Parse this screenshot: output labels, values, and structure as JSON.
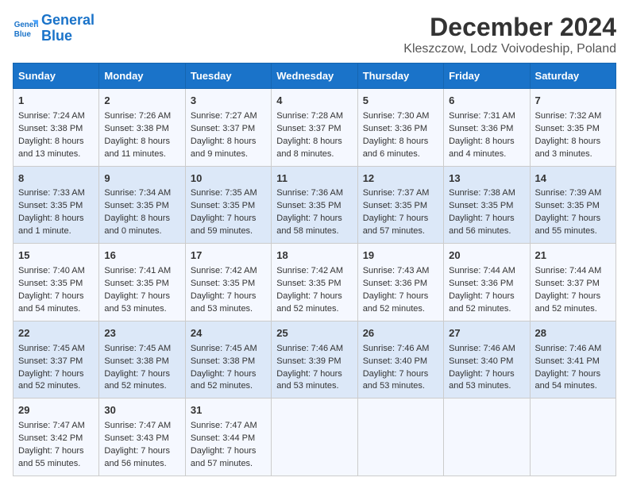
{
  "logo": {
    "line1": "General",
    "line2": "Blue"
  },
  "title": "December 2024",
  "subtitle": "Kleszczow, Lodz Voivodeship, Poland",
  "days_of_week": [
    "Sunday",
    "Monday",
    "Tuesday",
    "Wednesday",
    "Thursday",
    "Friday",
    "Saturday"
  ],
  "weeks": [
    [
      {
        "day": 1,
        "lines": [
          "Sunrise: 7:24 AM",
          "Sunset: 3:38 PM",
          "Daylight: 8 hours",
          "and 13 minutes."
        ]
      },
      {
        "day": 2,
        "lines": [
          "Sunrise: 7:26 AM",
          "Sunset: 3:38 PM",
          "Daylight: 8 hours",
          "and 11 minutes."
        ]
      },
      {
        "day": 3,
        "lines": [
          "Sunrise: 7:27 AM",
          "Sunset: 3:37 PM",
          "Daylight: 8 hours",
          "and 9 minutes."
        ]
      },
      {
        "day": 4,
        "lines": [
          "Sunrise: 7:28 AM",
          "Sunset: 3:37 PM",
          "Daylight: 8 hours",
          "and 8 minutes."
        ]
      },
      {
        "day": 5,
        "lines": [
          "Sunrise: 7:30 AM",
          "Sunset: 3:36 PM",
          "Daylight: 8 hours",
          "and 6 minutes."
        ]
      },
      {
        "day": 6,
        "lines": [
          "Sunrise: 7:31 AM",
          "Sunset: 3:36 PM",
          "Daylight: 8 hours",
          "and 4 minutes."
        ]
      },
      {
        "day": 7,
        "lines": [
          "Sunrise: 7:32 AM",
          "Sunset: 3:35 PM",
          "Daylight: 8 hours",
          "and 3 minutes."
        ]
      }
    ],
    [
      {
        "day": 8,
        "lines": [
          "Sunrise: 7:33 AM",
          "Sunset: 3:35 PM",
          "Daylight: 8 hours",
          "and 1 minute."
        ]
      },
      {
        "day": 9,
        "lines": [
          "Sunrise: 7:34 AM",
          "Sunset: 3:35 PM",
          "Daylight: 8 hours",
          "and 0 minutes."
        ]
      },
      {
        "day": 10,
        "lines": [
          "Sunrise: 7:35 AM",
          "Sunset: 3:35 PM",
          "Daylight: 7 hours",
          "and 59 minutes."
        ]
      },
      {
        "day": 11,
        "lines": [
          "Sunrise: 7:36 AM",
          "Sunset: 3:35 PM",
          "Daylight: 7 hours",
          "and 58 minutes."
        ]
      },
      {
        "day": 12,
        "lines": [
          "Sunrise: 7:37 AM",
          "Sunset: 3:35 PM",
          "Daylight: 7 hours",
          "and 57 minutes."
        ]
      },
      {
        "day": 13,
        "lines": [
          "Sunrise: 7:38 AM",
          "Sunset: 3:35 PM",
          "Daylight: 7 hours",
          "and 56 minutes."
        ]
      },
      {
        "day": 14,
        "lines": [
          "Sunrise: 7:39 AM",
          "Sunset: 3:35 PM",
          "Daylight: 7 hours",
          "and 55 minutes."
        ]
      }
    ],
    [
      {
        "day": 15,
        "lines": [
          "Sunrise: 7:40 AM",
          "Sunset: 3:35 PM",
          "Daylight: 7 hours",
          "and 54 minutes."
        ]
      },
      {
        "day": 16,
        "lines": [
          "Sunrise: 7:41 AM",
          "Sunset: 3:35 PM",
          "Daylight: 7 hours",
          "and 53 minutes."
        ]
      },
      {
        "day": 17,
        "lines": [
          "Sunrise: 7:42 AM",
          "Sunset: 3:35 PM",
          "Daylight: 7 hours",
          "and 53 minutes."
        ]
      },
      {
        "day": 18,
        "lines": [
          "Sunrise: 7:42 AM",
          "Sunset: 3:35 PM",
          "Daylight: 7 hours",
          "and 52 minutes."
        ]
      },
      {
        "day": 19,
        "lines": [
          "Sunrise: 7:43 AM",
          "Sunset: 3:36 PM",
          "Daylight: 7 hours",
          "and 52 minutes."
        ]
      },
      {
        "day": 20,
        "lines": [
          "Sunrise: 7:44 AM",
          "Sunset: 3:36 PM",
          "Daylight: 7 hours",
          "and 52 minutes."
        ]
      },
      {
        "day": 21,
        "lines": [
          "Sunrise: 7:44 AM",
          "Sunset: 3:37 PM",
          "Daylight: 7 hours",
          "and 52 minutes."
        ]
      }
    ],
    [
      {
        "day": 22,
        "lines": [
          "Sunrise: 7:45 AM",
          "Sunset: 3:37 PM",
          "Daylight: 7 hours",
          "and 52 minutes."
        ]
      },
      {
        "day": 23,
        "lines": [
          "Sunrise: 7:45 AM",
          "Sunset: 3:38 PM",
          "Daylight: 7 hours",
          "and 52 minutes."
        ]
      },
      {
        "day": 24,
        "lines": [
          "Sunrise: 7:45 AM",
          "Sunset: 3:38 PM",
          "Daylight: 7 hours",
          "and 52 minutes."
        ]
      },
      {
        "day": 25,
        "lines": [
          "Sunrise: 7:46 AM",
          "Sunset: 3:39 PM",
          "Daylight: 7 hours",
          "and 53 minutes."
        ]
      },
      {
        "day": 26,
        "lines": [
          "Sunrise: 7:46 AM",
          "Sunset: 3:40 PM",
          "Daylight: 7 hours",
          "and 53 minutes."
        ]
      },
      {
        "day": 27,
        "lines": [
          "Sunrise: 7:46 AM",
          "Sunset: 3:40 PM",
          "Daylight: 7 hours",
          "and 53 minutes."
        ]
      },
      {
        "day": 28,
        "lines": [
          "Sunrise: 7:46 AM",
          "Sunset: 3:41 PM",
          "Daylight: 7 hours",
          "and 54 minutes."
        ]
      }
    ],
    [
      {
        "day": 29,
        "lines": [
          "Sunrise: 7:47 AM",
          "Sunset: 3:42 PM",
          "Daylight: 7 hours",
          "and 55 minutes."
        ]
      },
      {
        "day": 30,
        "lines": [
          "Sunrise: 7:47 AM",
          "Sunset: 3:43 PM",
          "Daylight: 7 hours",
          "and 56 minutes."
        ]
      },
      {
        "day": 31,
        "lines": [
          "Sunrise: 7:47 AM",
          "Sunset: 3:44 PM",
          "Daylight: 7 hours",
          "and 57 minutes."
        ]
      },
      null,
      null,
      null,
      null
    ]
  ]
}
